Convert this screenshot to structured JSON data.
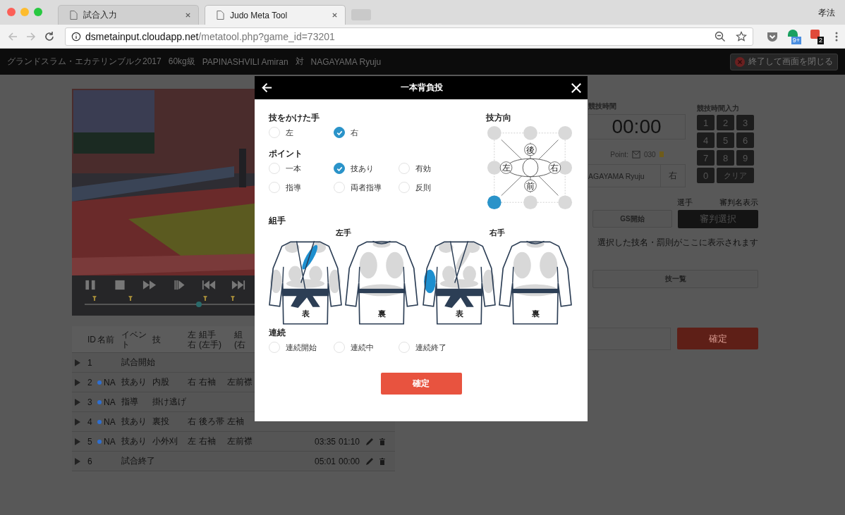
{
  "browser": {
    "tabs": [
      {
        "title": "試合入力",
        "selected": false
      },
      {
        "title": "Judo Meta Tool",
        "selected": true
      }
    ],
    "profile": "孝法",
    "url_host": "dsmetainput.cloudapp.net",
    "url_path": "/metatool.php?game_id=73201",
    "badges": [
      "9+",
      "2"
    ]
  },
  "header": {
    "items": [
      "グランドスラム・エカテリンブルク2017",
      "60kg級",
      "PAPINASHVILI Amiran",
      "対",
      "NAGAYAMA Ryuju"
    ],
    "close_button": "終了して画面を閉じる"
  },
  "table": {
    "columns": [
      "ID",
      "名前",
      "イベント",
      "技",
      "左右",
      "組手\n(左手)",
      "組\n(右"
    ],
    "rows": [
      {
        "id": "1",
        "event": "試合開始"
      },
      {
        "id": "2",
        "player": "NA",
        "color": "#2f6fd0",
        "event": "技あり",
        "technique": "内股",
        "side": "右",
        "grip_left": "右袖",
        "grip_right": "左前襟"
      },
      {
        "id": "3",
        "player": "NA",
        "color": "#2f6fd0",
        "event": "指導",
        "technique": "掛け逃げ"
      },
      {
        "id": "4",
        "player": "NA",
        "color": "#2f6fd0",
        "event": "技あり",
        "technique": "裏投",
        "side": "右",
        "grip_left": "後ろ帯",
        "grip_right": "左袖"
      },
      {
        "id": "5",
        "player": "NA",
        "color": "#2f6fd0",
        "event": "技あり",
        "technique": "小外刈",
        "side": "左",
        "grip_left": "右袖",
        "grip_right": "左前襟",
        "start": "03:35",
        "end": "01:10"
      },
      {
        "id": "6",
        "event": "試合終了",
        "start": "05:01",
        "end": "00:00"
      }
    ]
  },
  "panel": {
    "time_label": "競技時間",
    "time": "00:00",
    "point_label": "Point:",
    "point_value": "030",
    "player_name": "AGAYAMA Ryuju",
    "player_side": "右",
    "keypad_label": "競技時間入力",
    "keys": [
      "1",
      "2",
      "3",
      "4",
      "5",
      "6",
      "7",
      "8",
      "9",
      "0",
      "クリア"
    ],
    "player_label": "選手",
    "referee_label": "審判名表示",
    "gs_button": "GS開始",
    "referee_button": "審判選択",
    "hint": "選択した技名・罰則がここに表示されます",
    "technique_list_button": "技一覧",
    "confirm_button": "確定"
  },
  "modal": {
    "title": "一本背負投",
    "hand": {
      "title": "技をかけた手",
      "options": [
        {
          "label": "左",
          "selected": false
        },
        {
          "label": "右",
          "selected": true
        }
      ]
    },
    "point": {
      "title": "ポイント",
      "options": [
        {
          "label": "一本",
          "selected": false
        },
        {
          "label": "技あり",
          "selected": true
        },
        {
          "label": "有効",
          "selected": false
        },
        {
          "label": "指導",
          "selected": false
        },
        {
          "label": "両者指導",
          "selected": false
        },
        {
          "label": "反則",
          "selected": false
        }
      ]
    },
    "direction": {
      "title": "技方向",
      "labels": [
        "後",
        "左",
        "右",
        "前"
      ],
      "options": [
        {
          "selected": false
        },
        {
          "selected": false
        },
        {
          "selected": false
        },
        {
          "selected": false
        },
        {
          "selected": false
        },
        {
          "selected": true
        },
        {
          "selected": false
        },
        {
          "selected": false
        }
      ]
    },
    "grip": {
      "title": "組手",
      "hands": [
        {
          "label": "左手",
          "views": [
            {
              "kind": "front",
              "label": "表",
              "zones": [
                {
                  "selected": false
                },
                {
                  "selected": false
                },
                {
                  "selected": true
                },
                {
                  "selected": false
                },
                {
                  "selected": false
                },
                {
                  "selected": false
                },
                {
                  "selected": false
                },
                {
                  "selected": false
                }
              ]
            },
            {
              "kind": "back",
              "label": "裏",
              "zones": [
                {
                  "selected": false
                },
                {
                  "selected": false
                },
                {
                  "selected": false
                },
                {
                  "selected": false
                }
              ]
            }
          ]
        },
        {
          "label": "右手",
          "views": [
            {
              "kind": "front",
              "label": "表",
              "zones": [
                {
                  "selected": false
                },
                {
                  "selected": false
                },
                {
                  "selected": false
                },
                {
                  "selected": false
                },
                {
                  "selected": false
                },
                {
                  "selected": true
                },
                {
                  "selected": false
                },
                {
                  "selected": false
                }
              ]
            },
            {
              "kind": "back",
              "label": "裏",
              "zones": [
                {
                  "selected": false
                },
                {
                  "selected": false
                },
                {
                  "selected": false
                },
                {
                  "selected": false
                }
              ]
            }
          ]
        }
      ]
    },
    "combo": {
      "title": "連続",
      "options": [
        {
          "label": "連続開始",
          "selected": false
        },
        {
          "label": "連続中",
          "selected": false
        },
        {
          "label": "連続終了",
          "selected": false
        }
      ]
    },
    "confirm_button": "確定"
  }
}
